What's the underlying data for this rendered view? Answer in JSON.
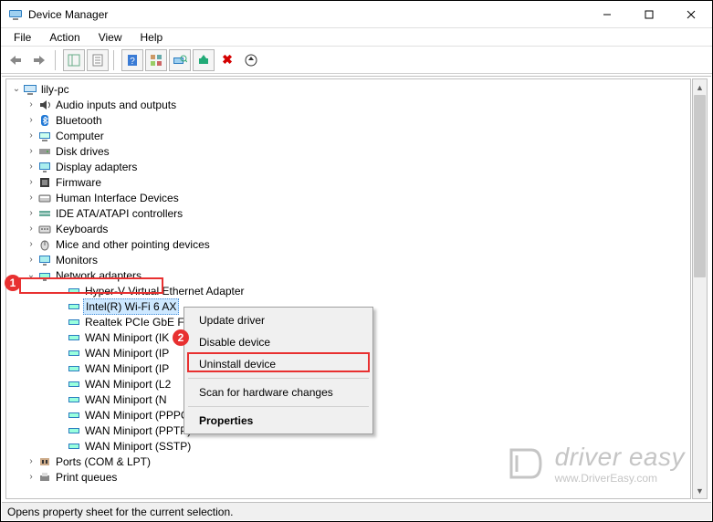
{
  "window": {
    "title": "Device Manager"
  },
  "menu": {
    "file": "File",
    "action": "Action",
    "view": "View",
    "help": "Help"
  },
  "tree": {
    "root": "lily-pc",
    "categories": [
      {
        "label": "Audio inputs and outputs",
        "icon": "audio"
      },
      {
        "label": "Bluetooth",
        "icon": "bluetooth"
      },
      {
        "label": "Computer",
        "icon": "computer"
      },
      {
        "label": "Disk drives",
        "icon": "disk"
      },
      {
        "label": "Display adapters",
        "icon": "display"
      },
      {
        "label": "Firmware",
        "icon": "firmware"
      },
      {
        "label": "Human Interface Devices",
        "icon": "hid"
      },
      {
        "label": "IDE ATA/ATAPI controllers",
        "icon": "ide"
      },
      {
        "label": "Keyboards",
        "icon": "keyboard"
      },
      {
        "label": "Mice and other pointing devices",
        "icon": "mouse"
      },
      {
        "label": "Monitors",
        "icon": "monitor"
      },
      {
        "label": "Network adapters",
        "icon": "network",
        "expanded": true,
        "highlighted": true
      },
      {
        "label": "Ports (COM & LPT)",
        "icon": "ports"
      },
      {
        "label": "Print queues",
        "icon": "print"
      }
    ],
    "network_children": [
      {
        "label": "Hyper-V Virtual Ethernet Adapter"
      },
      {
        "label": "Intel(R) Wi-Fi 6 AX",
        "selected": true,
        "truncated": true
      },
      {
        "label": "Realtek PCIe GbE F",
        "truncated": true
      },
      {
        "label": "WAN Miniport (IK",
        "truncated": true
      },
      {
        "label": "WAN Miniport (IP",
        "truncated": true
      },
      {
        "label": "WAN Miniport (IP",
        "truncated": true
      },
      {
        "label": "WAN Miniport (L2",
        "truncated": true
      },
      {
        "label": "WAN Miniport (N",
        "truncated": true
      },
      {
        "label": "WAN Miniport (PPPOE)"
      },
      {
        "label": "WAN Miniport (PPTP)"
      },
      {
        "label": "WAN Miniport (SSTP)"
      }
    ]
  },
  "context_menu": {
    "update": "Update driver",
    "disable": "Disable device",
    "uninstall": "Uninstall device",
    "scan": "Scan for hardware changes",
    "properties": "Properties"
  },
  "callouts": {
    "one": "1",
    "two": "2"
  },
  "statusbar": "Opens property sheet for the current selection.",
  "watermark": {
    "brand": "driver easy",
    "url": "www.DriverEasy.com"
  }
}
